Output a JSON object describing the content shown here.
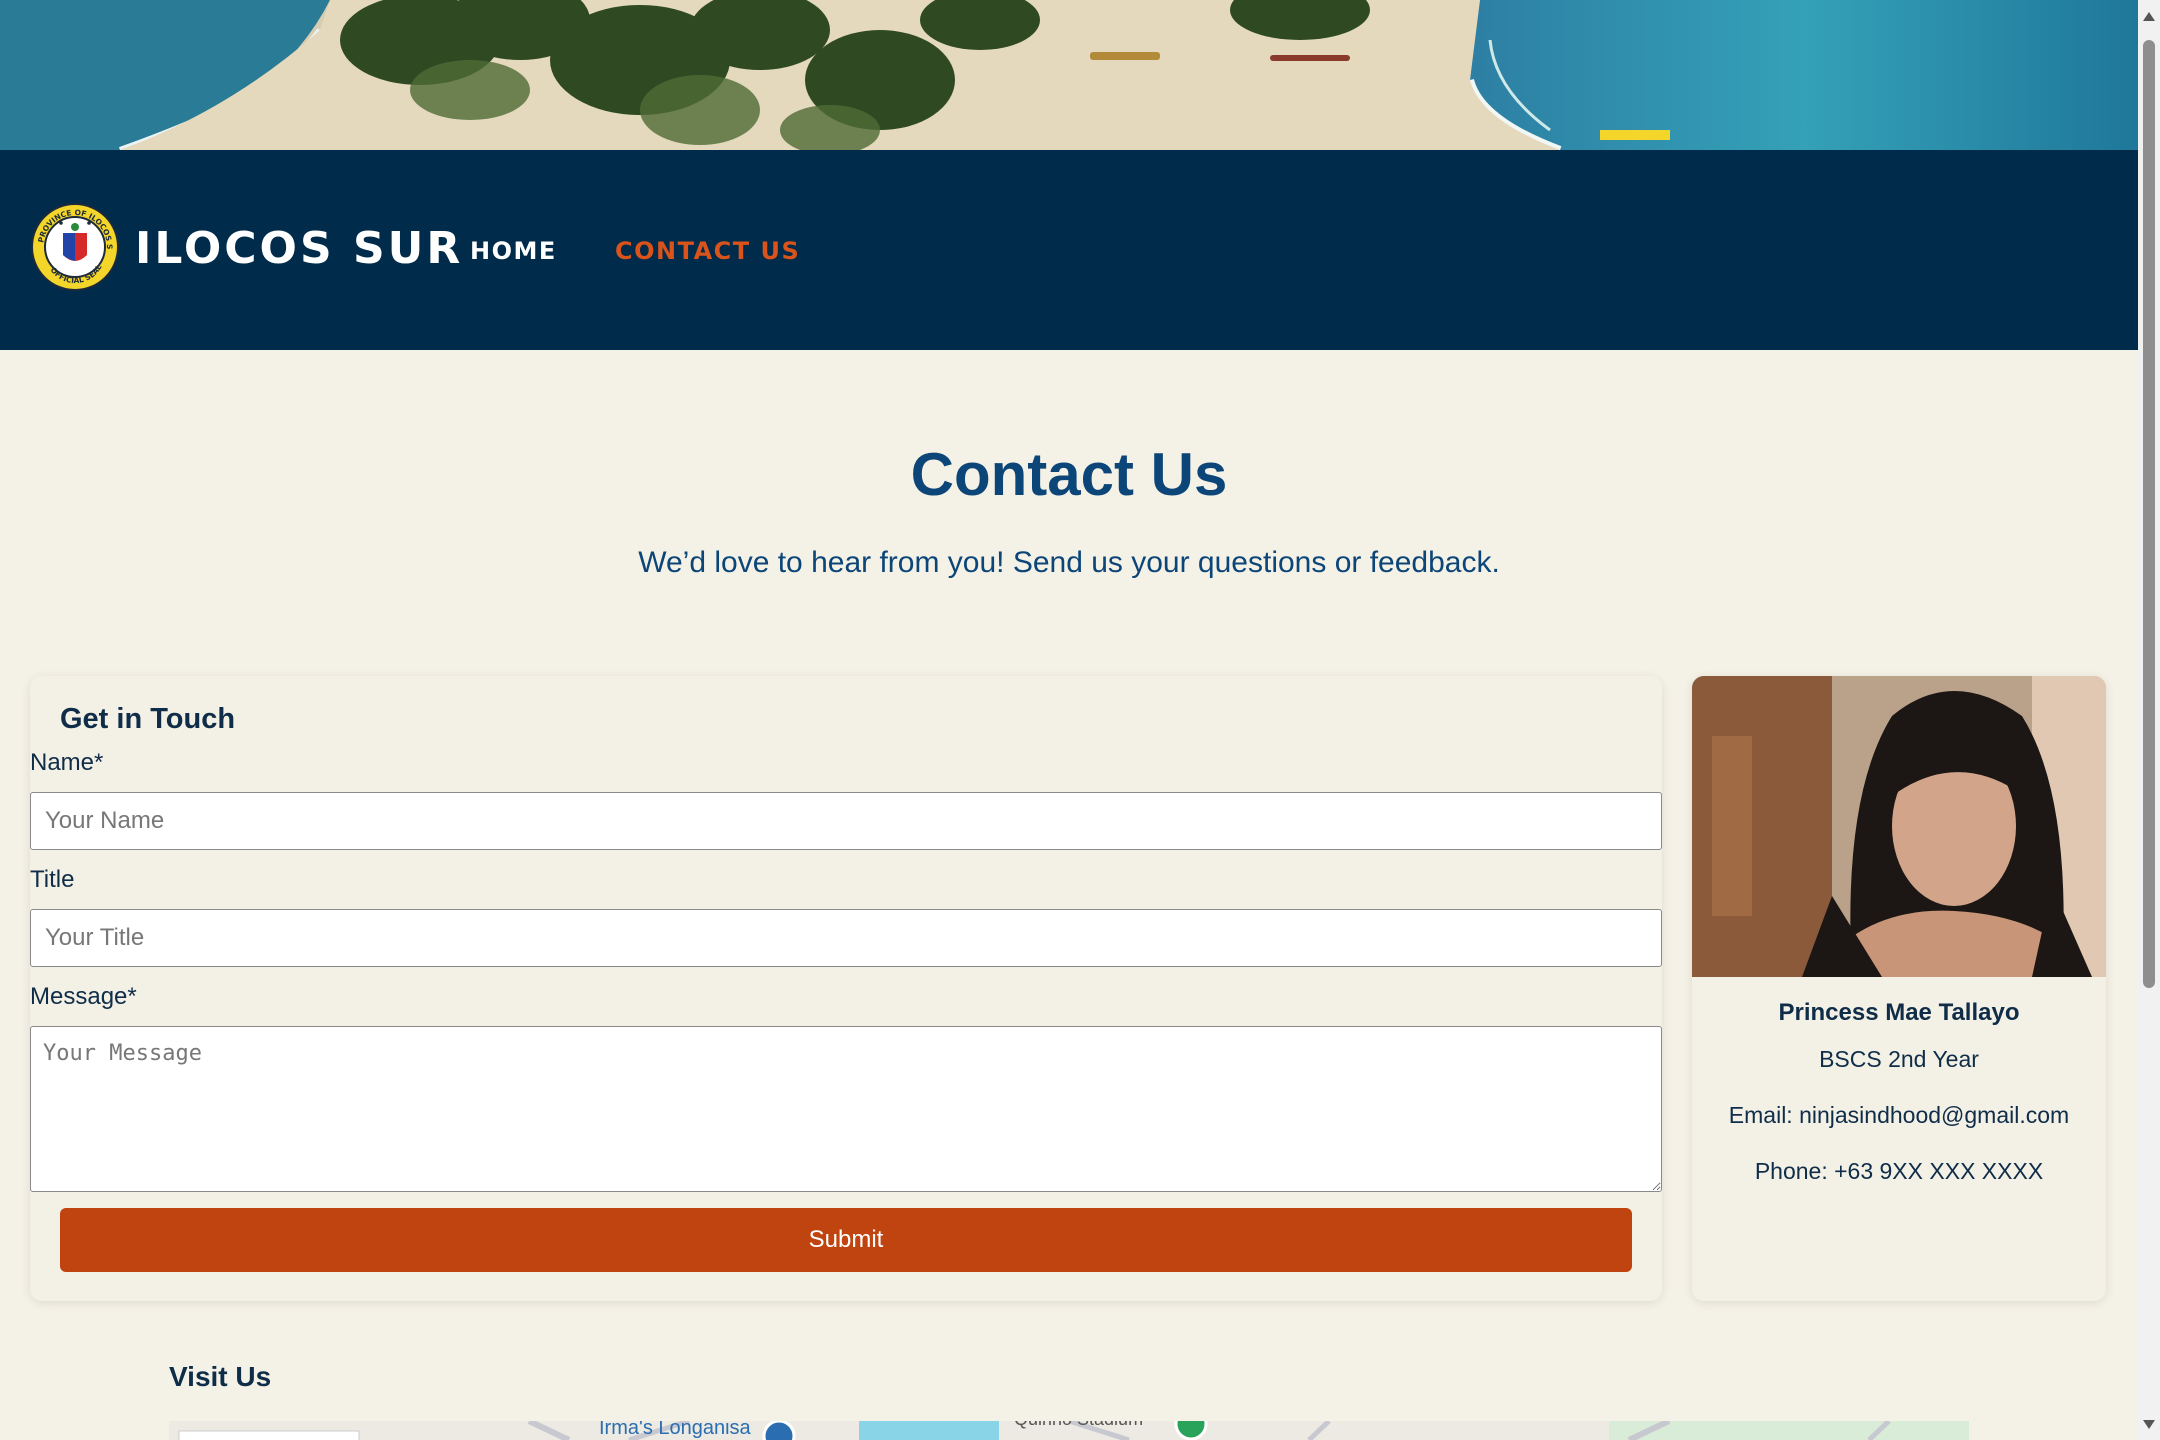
{
  "header": {
    "brand": "ILOCOS SUR",
    "seal_text_top": "PROVINCE OF ILOCOS SUR",
    "seal_text_bottom": "OFFICIAL SEAL",
    "nav": [
      {
        "label": "HOME",
        "active": false
      },
      {
        "label": "CONTACT US",
        "active": true
      }
    ],
    "active_color": "#d9531b",
    "bar_color": "#002b4a"
  },
  "page": {
    "title": "Contact Us",
    "subtitle": "We’d love to hear from you! Send us your questions or feedback."
  },
  "form": {
    "heading": "Get in Touch",
    "name_label": "Name*",
    "name_placeholder": "Your Name",
    "name_value": "",
    "title_label": "Title",
    "title_placeholder": "Your Title",
    "title_value": "",
    "message_label": "Message*",
    "message_placeholder": "Your Message",
    "message_value": "",
    "submit_label": "Submit",
    "submit_color": "#c0440f"
  },
  "profile": {
    "name": "Princess Mae Tallayo",
    "course": "BSCS 2nd Year",
    "email": "Email: ninjasindhood@gmail.com",
    "phone": "Phone: +63 9XX XXX XXXX"
  },
  "visit": {
    "heading": "Visit Us",
    "map_label_1": "Irma's Longanisa",
    "map_label_2": "Quirino Stadium"
  },
  "icons": {
    "seal": "provincial-seal-icon",
    "map_pin": "map-pin-icon"
  }
}
